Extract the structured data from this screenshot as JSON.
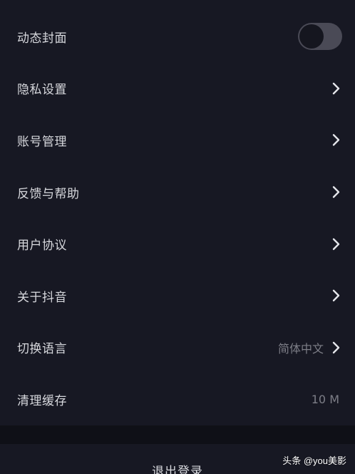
{
  "settings": {
    "dynamic_cover": {
      "label": "动态封面",
      "enabled": false
    },
    "privacy": {
      "label": "隐私设置"
    },
    "account": {
      "label": "账号管理"
    },
    "feedback": {
      "label": "反馈与帮助"
    },
    "agreement": {
      "label": "用户协议"
    },
    "about": {
      "label": "关于抖音"
    },
    "language": {
      "label": "切换语言",
      "value": "简体中文"
    },
    "cache": {
      "label": "清理缓存",
      "value": "10 M"
    }
  },
  "logout": {
    "label": "退出登录"
  },
  "watermark": {
    "text": "头条 @you美影"
  },
  "colors": {
    "background": "#171823",
    "text": "#d7d8dd",
    "muted_text": "#7d7e87",
    "toggle_track": "#4a4a56"
  },
  "icons": {
    "row_arrow": "chevron-right-icon"
  }
}
